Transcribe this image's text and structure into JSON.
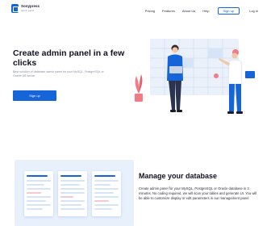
{
  "brand": {
    "name": "Sonypress",
    "tagline": "admin panel"
  },
  "nav": {
    "links": [
      "Pricing",
      "Features",
      "About Us",
      "Help"
    ],
    "signup_label": "Sign up",
    "login_label": "Log in"
  },
  "hero": {
    "title": "Create admin panel in a few clicks",
    "subtitle": "Best solution of database admin panel for your MySQL, PostgreSQL or Oracle DB server",
    "cta_label": "Sign up"
  },
  "section2": {
    "title": "Manage your database",
    "text": "Create admin panel for your MySQL, PostgreSQL or Oracle database in 3 minutes. No coding required, we will scan your tables and generate UI. You will be able to customize display or edit parameters in our management panel"
  },
  "colors": {
    "accent": "#1565d8",
    "light_bg": "#e8f0fb",
    "dark_text": "#111122"
  },
  "icons": [
    "logo-icon",
    "plant-icon"
  ]
}
